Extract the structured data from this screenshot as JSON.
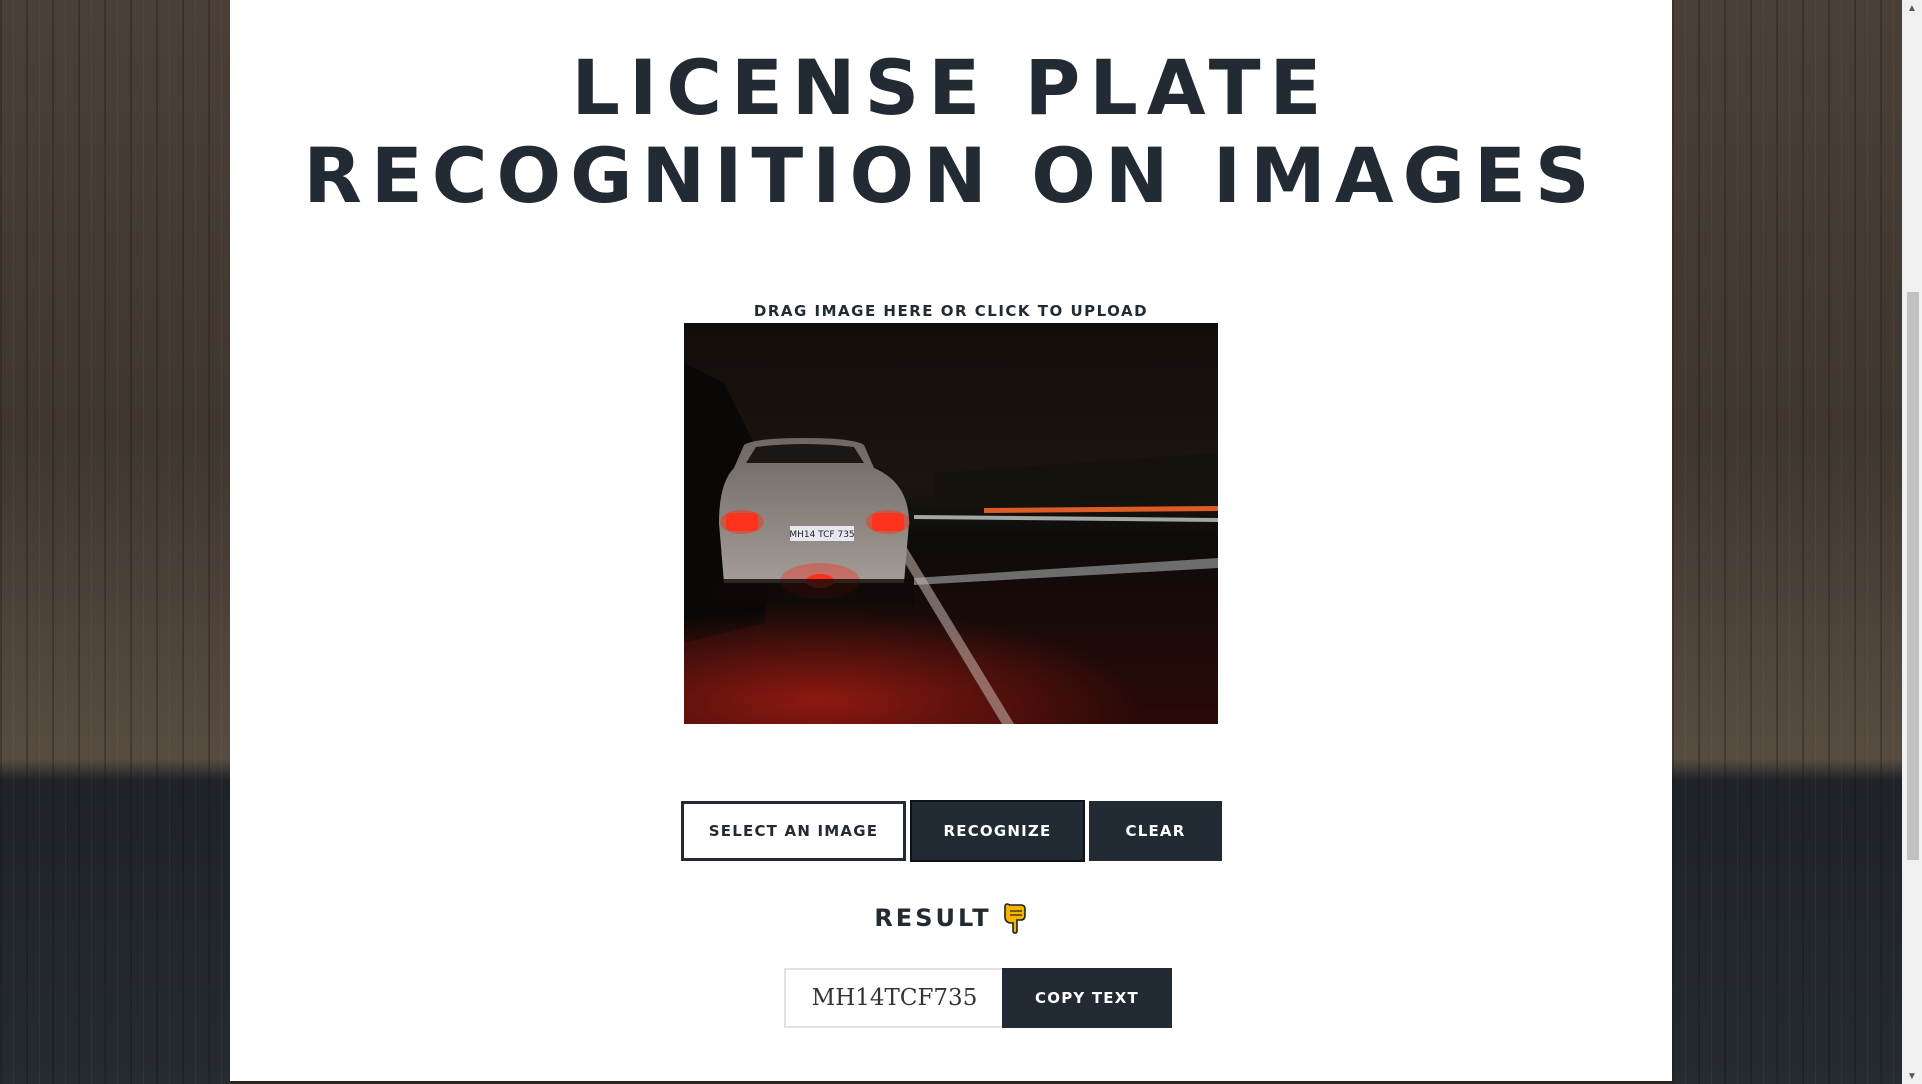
{
  "page": {
    "title_line1": "LICENSE PLATE",
    "title_line2": "RECOGNITION ON IMAGES"
  },
  "upload": {
    "label": "DRAG IMAGE HERE OR CLICK TO UPLOAD",
    "image_plate_text": "MH14 TCF 735"
  },
  "buttons": {
    "select": "SELECT AN IMAGE",
    "recognize": "RECOGNIZE",
    "clear": "CLEAR",
    "copy": "COPY TEXT"
  },
  "result": {
    "heading": "RESULT",
    "value": "MH14TCF735",
    "icon": "pointing-down-hand-icon"
  },
  "colors": {
    "primary": "#222b33",
    "background_panel": "#ffffff"
  }
}
